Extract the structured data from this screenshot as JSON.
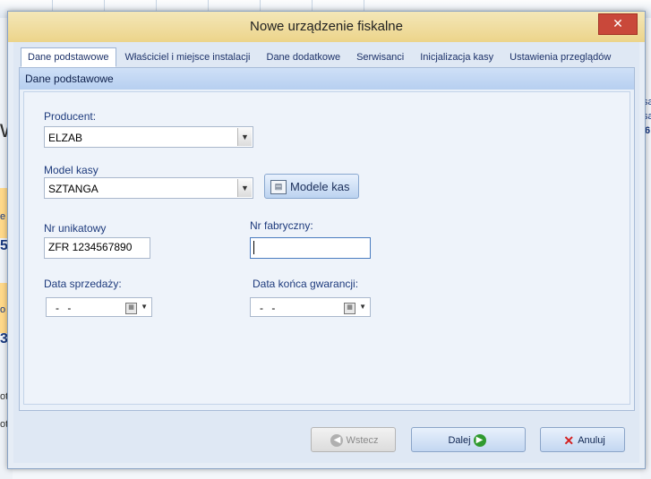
{
  "dialog": {
    "title": "Nowe urządzenie fiskalne",
    "close_glyph": "✕"
  },
  "tabs": [
    {
      "label": "Dane podstawowe",
      "active": true
    },
    {
      "label": "Właściciel i miejsce instalacji"
    },
    {
      "label": "Dane dodatkowe"
    },
    {
      "label": "Serwisanci"
    },
    {
      "label": "Inicjalizacja kasy"
    },
    {
      "label": "Ustawienia przeglądów"
    }
  ],
  "panel": {
    "header": "Dane podstawowe"
  },
  "form": {
    "producent": {
      "label": "Producent:",
      "value": "ELZAB"
    },
    "model": {
      "label": "Model kasy",
      "value": "SZTANGA",
      "button_label": "Modele kas"
    },
    "nr_unikatowy": {
      "label": "Nr unikatowy",
      "value": "ZFR 1234567890"
    },
    "nr_fabryczny": {
      "label": "Nr fabryczny:",
      "value": ""
    },
    "data_sprzedazy": {
      "label": "Data sprzedaży:",
      "value": "-  -"
    },
    "data_gwarancji": {
      "label": "Data końca gwarancji:",
      "value": "-  -"
    }
  },
  "buttons": {
    "back": {
      "label": "Wstecz",
      "icon": "arrow-left-icon",
      "enabled": false
    },
    "next": {
      "label": "Dalej",
      "icon": "arrow-right-icon",
      "enabled": true
    },
    "cancel": {
      "label": "Anuluj",
      "icon": "x-icon",
      "enabled": true
    }
  },
  "background": {
    "fragments": [
      "sa",
      "sa",
      "6",
      "e",
      "57",
      "o",
      "3",
      "ot",
      "ot",
      "w"
    ]
  },
  "colors": {
    "titlebar": "#ecd48a",
    "close": "#c9483a",
    "accent": "#b7cff0",
    "next_icon": "#2f9a2f",
    "cancel_icon": "#d42020"
  }
}
